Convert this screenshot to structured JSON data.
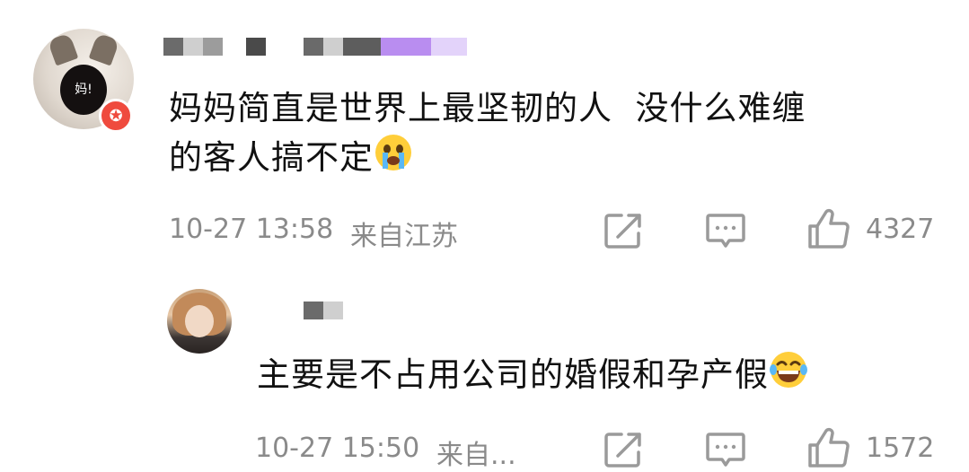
{
  "comment": {
    "text_line1": "妈妈简直是世界上最坚韧的人  没什么难缠",
    "text_line2": "的客人搞不定",
    "time": "10-27 13:58",
    "location": "来自江苏",
    "like_count": "4327",
    "avatar_badge": "妈!"
  },
  "reply": {
    "text": "主要是不占用公司的婚假和孕产假",
    "time": "10-27 15:50",
    "location": "来自...",
    "like_count": "1572"
  },
  "icons": [
    "share-icon",
    "comment-icon",
    "like-icon",
    "crying-emoji-icon",
    "laughing-emoji-icon",
    "vip-badge-icon"
  ],
  "colors": {
    "text": "#111111",
    "meta": "#8a8a8a",
    "badge": "#ef4b3e",
    "blur_purple": "#b98df0"
  }
}
